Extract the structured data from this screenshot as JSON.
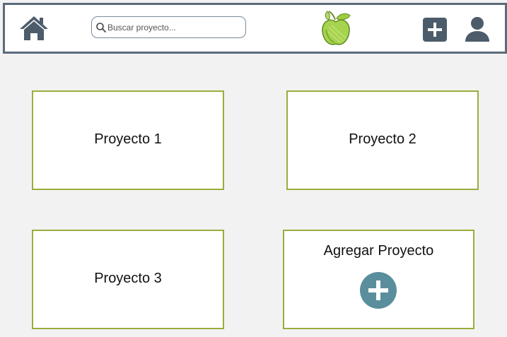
{
  "header": {
    "search": {
      "placeholder": "Buscar proyecto...",
      "value": ""
    }
  },
  "projects": [
    {
      "label": "Proyecto 1"
    },
    {
      "label": "Proyecto 2"
    },
    {
      "label": "Proyecto 3"
    }
  ],
  "add_project": {
    "label": "Agregar Proyecto"
  },
  "colors": {
    "header_border": "#5a6b7b",
    "icon_dark": "#4d5c6b",
    "card_border": "#9aad3c",
    "add_circle": "#5b8e9c",
    "logo_green": "#8ec63f",
    "background": "#f2f2f2"
  },
  "icons": {
    "home": "home-icon",
    "search": "search-icon",
    "logo": "apple-logo",
    "add": "plus-square-icon",
    "user": "user-icon",
    "add_project": "plus-circle-icon"
  }
}
